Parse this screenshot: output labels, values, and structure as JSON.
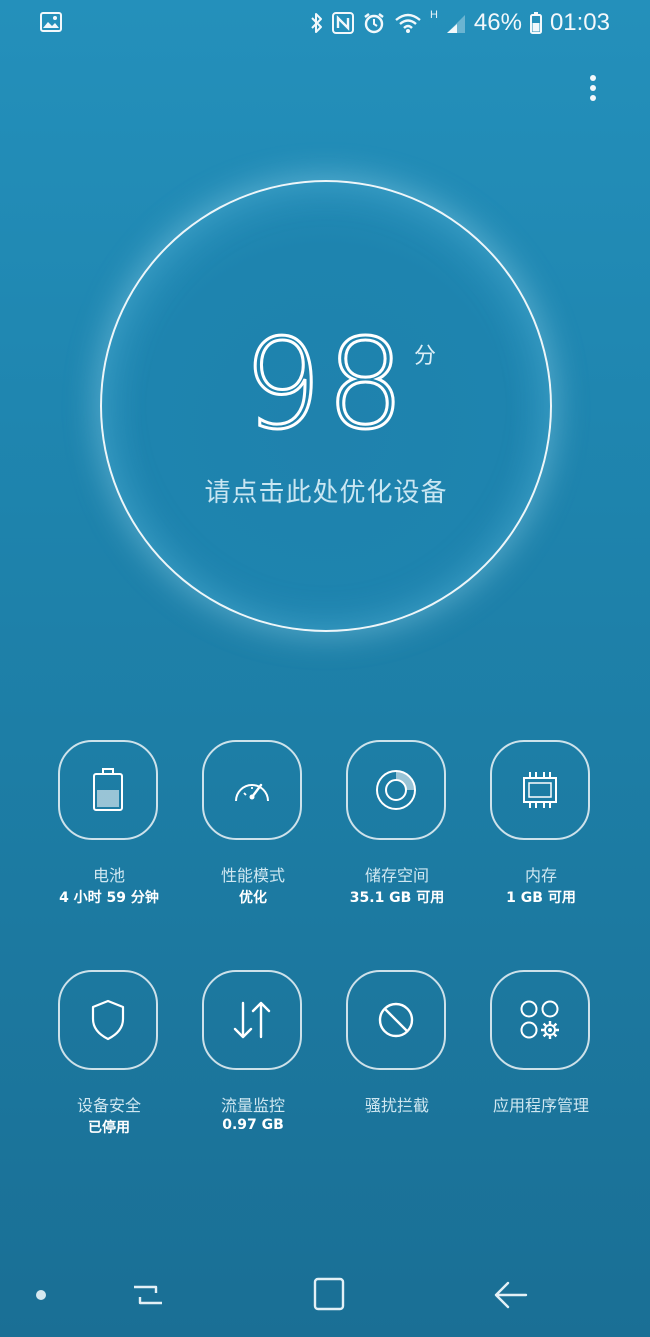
{
  "status_bar": {
    "network_mark": "H",
    "battery_percent": "46%",
    "time": "01:03",
    "icons": [
      "gallery-icon",
      "bluetooth-icon",
      "nfc-icon",
      "alarm-icon",
      "wifi-icon",
      "signal-icon",
      "battery-icon"
    ]
  },
  "score": {
    "value": "98",
    "unit": "分",
    "hint": "请点击此处优化设备"
  },
  "tiles": [
    {
      "icon": "battery-icon",
      "label": "电池",
      "sub": "4 小时 59 分钟"
    },
    {
      "icon": "performance-gauge-icon",
      "label": "性能模式",
      "sub": "优化"
    },
    {
      "icon": "storage-icon",
      "label": "储存空间",
      "sub": "35.1 GB 可用"
    },
    {
      "icon": "memory-chip-icon",
      "label": "内存",
      "sub": "1 GB 可用"
    },
    {
      "icon": "shield-icon",
      "label": "设备安全",
      "sub": "已停用"
    },
    {
      "icon": "data-usage-arrows-icon",
      "label": "流量监控",
      "sub": "0.97 GB"
    },
    {
      "icon": "block-icon",
      "label": "骚扰拦截",
      "sub": ""
    },
    {
      "icon": "app-manager-icon",
      "label": "应用程序管理",
      "sub": ""
    }
  ],
  "nav_bar": {
    "icons": [
      "nav-dot",
      "recent-apps-icon",
      "home-icon",
      "back-icon"
    ]
  },
  "colors": {
    "background_top": "#2490bb",
    "background_bottom": "#1a6f95",
    "foreground": "#ffffff",
    "muted_text": "#cfe7f1"
  }
}
